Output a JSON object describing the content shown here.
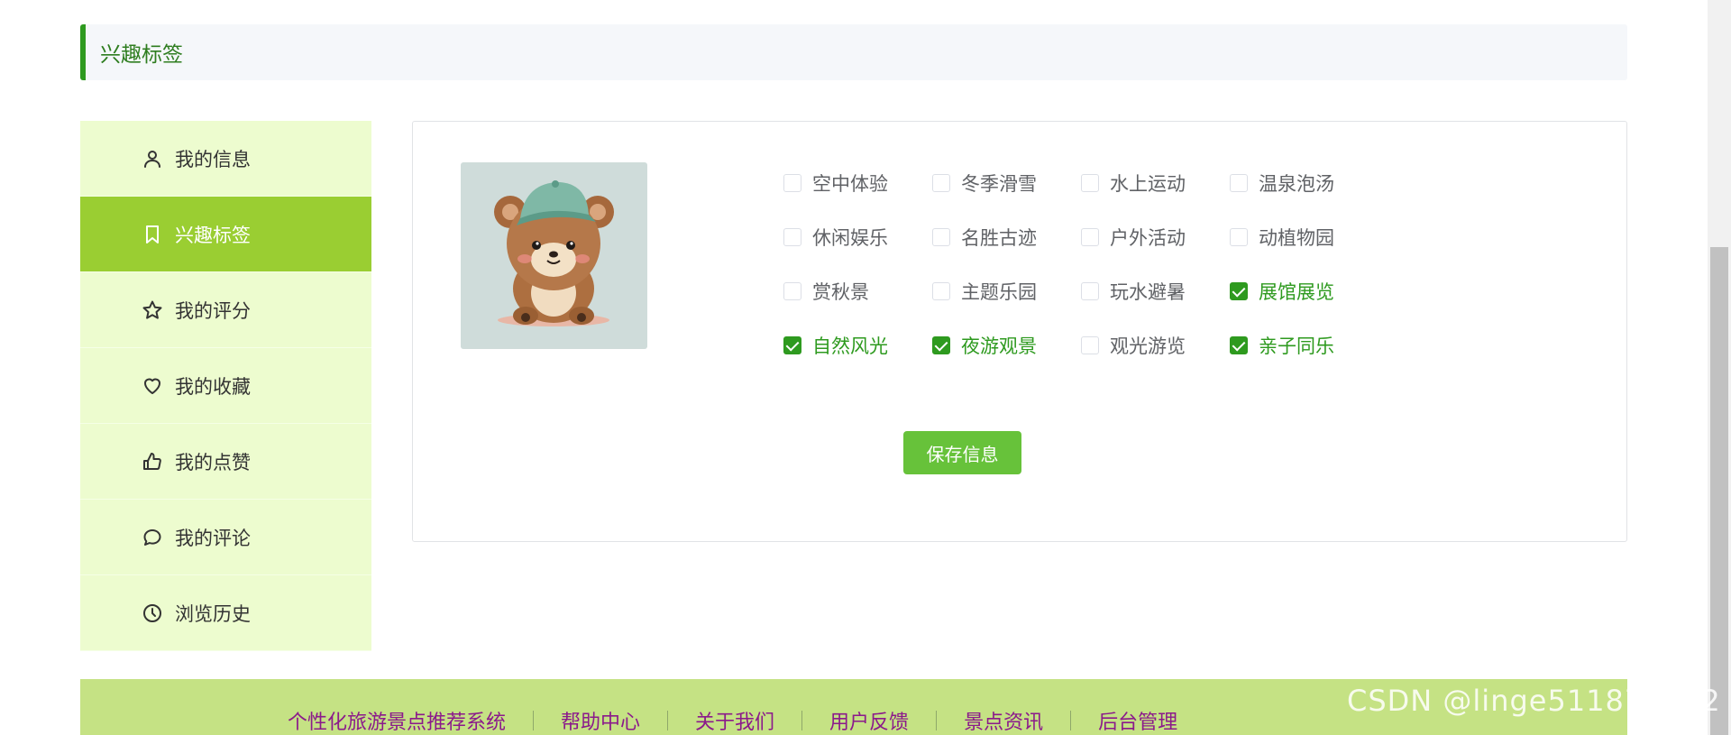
{
  "header": {
    "title": "兴趣标签"
  },
  "sidebar": {
    "items": [
      {
        "label": "我的信息",
        "icon": "user-icon",
        "active": false
      },
      {
        "label": "兴趣标签",
        "icon": "bookmark-icon",
        "active": true
      },
      {
        "label": "我的评分",
        "icon": "star-icon",
        "active": false
      },
      {
        "label": "我的收藏",
        "icon": "heart-icon",
        "active": false
      },
      {
        "label": "我的点赞",
        "icon": "thumbs-up-icon",
        "active": false
      },
      {
        "label": "我的评论",
        "icon": "comment-icon",
        "active": false
      },
      {
        "label": "浏览历史",
        "icon": "clock-icon",
        "active": false
      }
    ]
  },
  "tags": [
    {
      "label": "空中体验",
      "checked": false
    },
    {
      "label": "冬季滑雪",
      "checked": false
    },
    {
      "label": "水上运动",
      "checked": false
    },
    {
      "label": "温泉泡汤",
      "checked": false
    },
    {
      "label": "休闲娱乐",
      "checked": false
    },
    {
      "label": "名胜古迹",
      "checked": false
    },
    {
      "label": "户外活动",
      "checked": false
    },
    {
      "label": "动植物园",
      "checked": false
    },
    {
      "label": "赏秋景",
      "checked": false
    },
    {
      "label": "主题乐园",
      "checked": false
    },
    {
      "label": "玩水避暑",
      "checked": false
    },
    {
      "label": "展馆展览",
      "checked": true
    },
    {
      "label": "自然风光",
      "checked": true
    },
    {
      "label": "夜游观景",
      "checked": true
    },
    {
      "label": "观光游览",
      "checked": false
    },
    {
      "label": "亲子同乐",
      "checked": true
    }
  ],
  "actions": {
    "save_label": "保存信息"
  },
  "footer": {
    "links": [
      "个性化旅游景点推荐系统",
      "帮助中心",
      "关于我们",
      "用户反馈",
      "景点资讯",
      "后台管理"
    ]
  },
  "watermark": "CSDN @linge511873822",
  "colors": {
    "accent": "#2e9a1f",
    "sidebar_bg": "#edfccf",
    "active_bg": "#9ace32",
    "button": "#67c23a",
    "footer_bg": "#c5e284",
    "footer_link": "#8b1a8b"
  }
}
